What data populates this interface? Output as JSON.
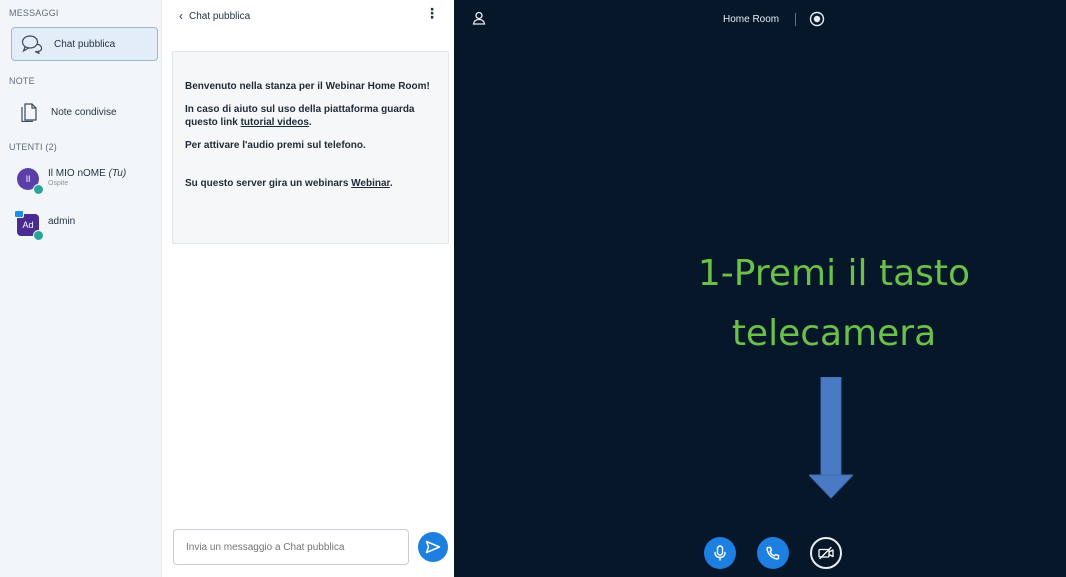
{
  "sidebar": {
    "messages_title": "MESSAGGI",
    "public_chat_label": "Chat pubblica",
    "notes_title": "NOTE",
    "shared_notes_label": "Note condivise",
    "users_title": "UTENTI (2)",
    "users": [
      {
        "initials": "Il",
        "name": "Il MIO nOME",
        "me_tag": "(Tu)",
        "role": "Ospite"
      },
      {
        "initials": "Ad",
        "name": "admin",
        "me_tag": "",
        "role": ""
      }
    ]
  },
  "chat": {
    "header_title": "Chat pubblica",
    "welcome": {
      "line1": "Benvenuto nella stanza per il Webinar Home Room!",
      "line2_prefix": "In caso di aiuto sul uso della piattaforma guarda questo link ",
      "line2_link": "tutorial videos",
      "line2_suffix": ".",
      "line3": "Per attivare l'audio premi sul telefono.",
      "line4_prefix": "Su questo server gira un webinars ",
      "line4_link": "Webinar",
      "line4_suffix": "."
    },
    "input_placeholder": "Invia un messaggio a Chat pubblica"
  },
  "stage": {
    "room_title": "Home Room",
    "overlay_line1": "1-Premi il tasto",
    "overlay_line2": "telecamera"
  },
  "colors": {
    "accent_blue": "#1d7fe0",
    "stage_bg": "#06172a",
    "overlay_green": "#6cc04a"
  },
  "icons": {
    "chat": "speech-bubbles-icon",
    "notes": "document-icon",
    "send": "send-arrow-icon",
    "user_toggle": "user-icon",
    "recording": "record-icon",
    "microphone": "microphone-icon",
    "phone": "phone-icon",
    "camera_off": "video-off-icon"
  }
}
